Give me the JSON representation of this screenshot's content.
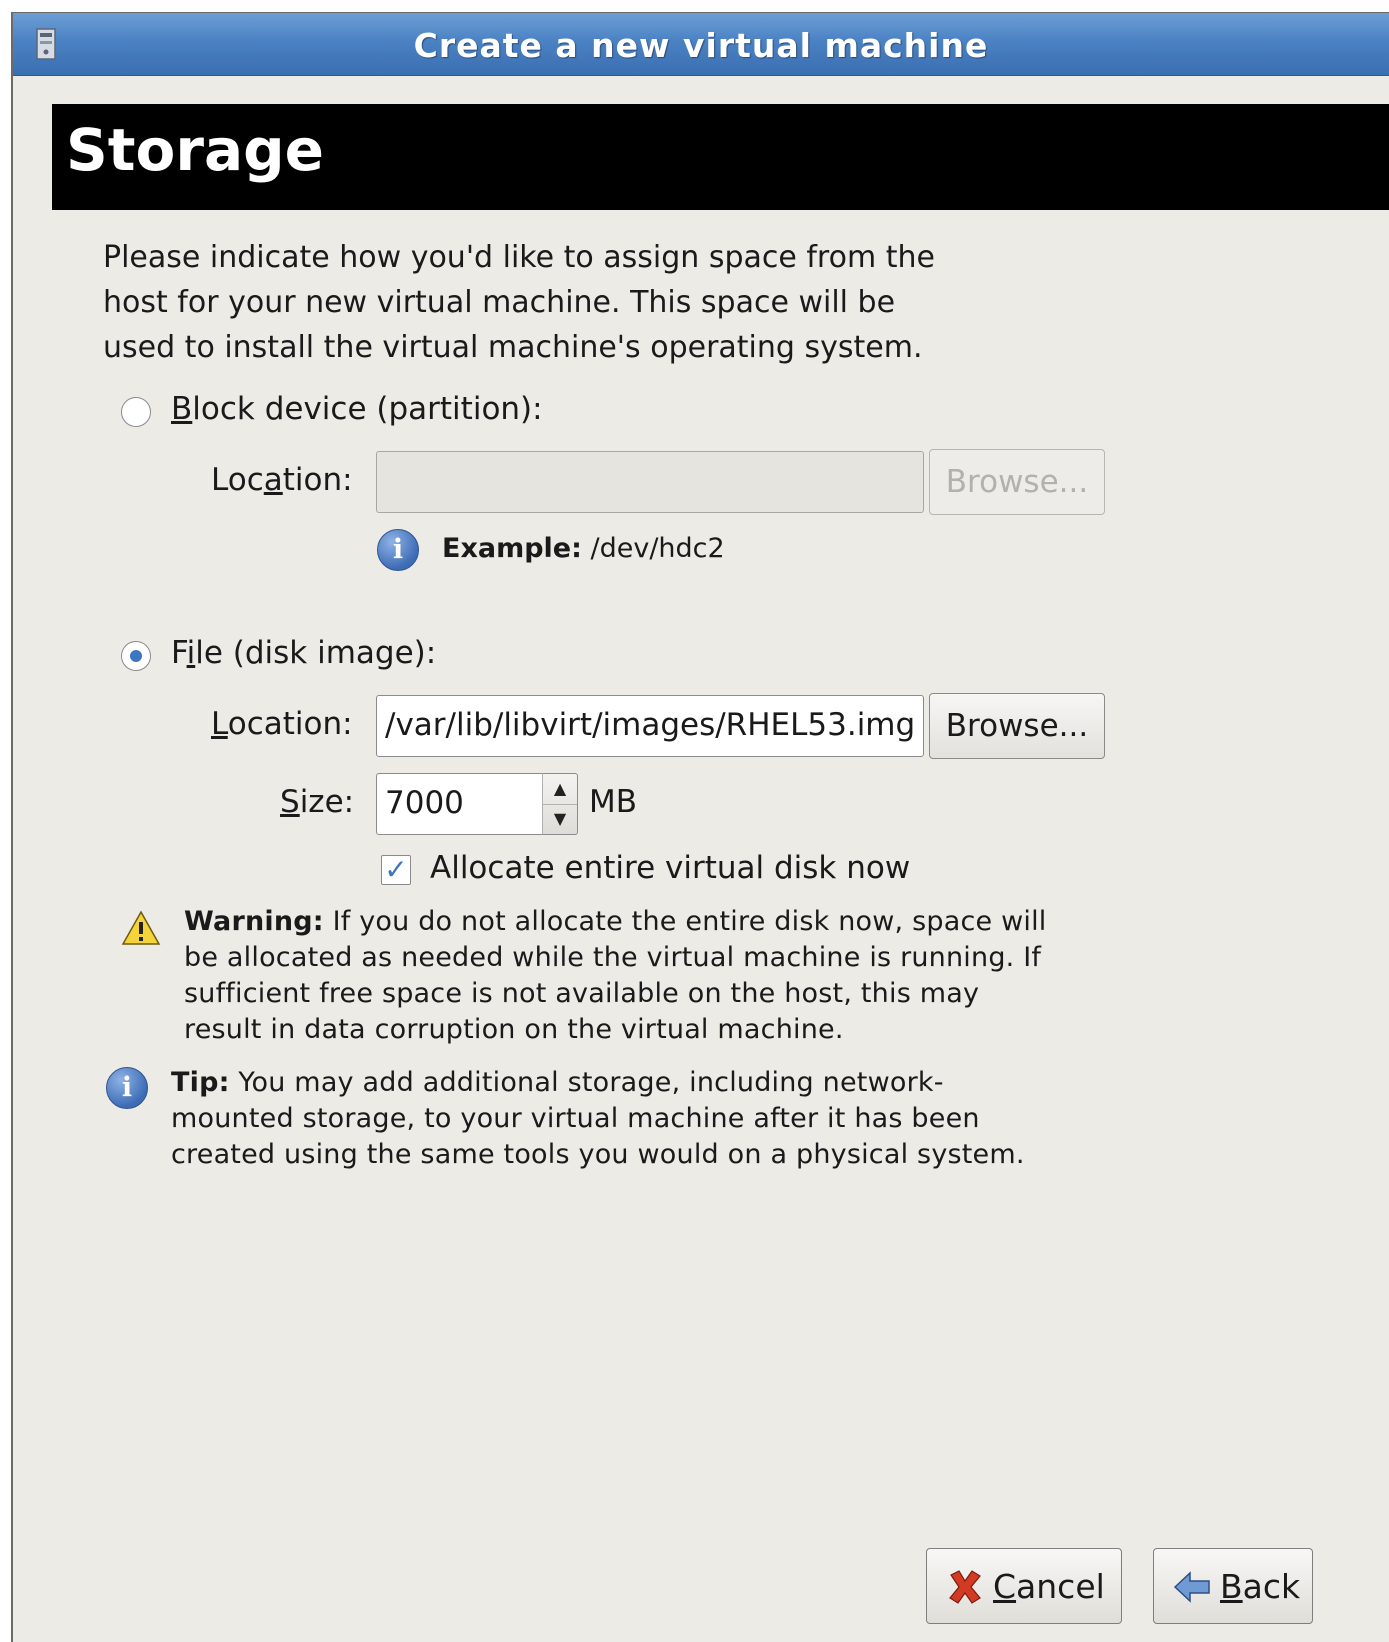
{
  "window": {
    "title": "Create a new virtual machine"
  },
  "page": {
    "heading": "Storage",
    "intro_lines": [
      "Please indicate how you'd like to assign space from the",
      "host for your new virtual machine. This space will be",
      "used to install the virtual machine's operating system."
    ]
  },
  "block_device": {
    "option_label_pre": "",
    "option_label_mnemonic": "B",
    "option_label_post": "lock device (partition):",
    "selected": false,
    "location_label_pre": "Loc",
    "location_label_mnemonic": "a",
    "location_label_post": "tion:",
    "location_value": "",
    "browse_label": "Browse...",
    "example_bold": "Example:",
    "example_text": " /dev/hdc2"
  },
  "file_image": {
    "option_label_pre": "F",
    "option_label_mnemonic": "i",
    "option_label_post": "le (disk image):",
    "selected": true,
    "location_label_pre": "",
    "location_label_mnemonic": "L",
    "location_label_post": "ocation:",
    "location_value": "/var/lib/libvirt/images/RHEL53.img",
    "browse_label": "Browse...",
    "size_label_mnemonic": "S",
    "size_label_post": "ize:",
    "size_value": "7000",
    "size_unit": "MB",
    "allocate_label": "Allocate entire virtual disk now",
    "allocate_checked": true
  },
  "warning": {
    "bold": "Warning:",
    "text_lines": [
      " If you do not allocate the entire disk now, space will",
      "be allocated as needed while the virtual machine is running. If",
      "sufficient free space is not available on the host, this may",
      "result in data corruption on the virtual machine."
    ]
  },
  "tip": {
    "bold": "Tip:",
    "text_lines": [
      " You may add additional storage, including network-",
      "mounted storage, to your virtual machine after it has been",
      "created using the same tools you would on a physical system."
    ]
  },
  "buttons": {
    "cancel_mnemonic": "C",
    "cancel_post": "ancel",
    "back_mnemonic": "B",
    "back_post": "ack"
  },
  "icons": {
    "app": "virt-manager-icon",
    "info": "info-icon",
    "warning": "warning-icon",
    "cancel": "cancel-x-icon",
    "back": "back-arrow-icon"
  },
  "colors": {
    "titlebar": "#4b82c4",
    "window_bg": "#edebe6",
    "banner_bg": "#000000",
    "radio_accent": "#3d76c3"
  }
}
